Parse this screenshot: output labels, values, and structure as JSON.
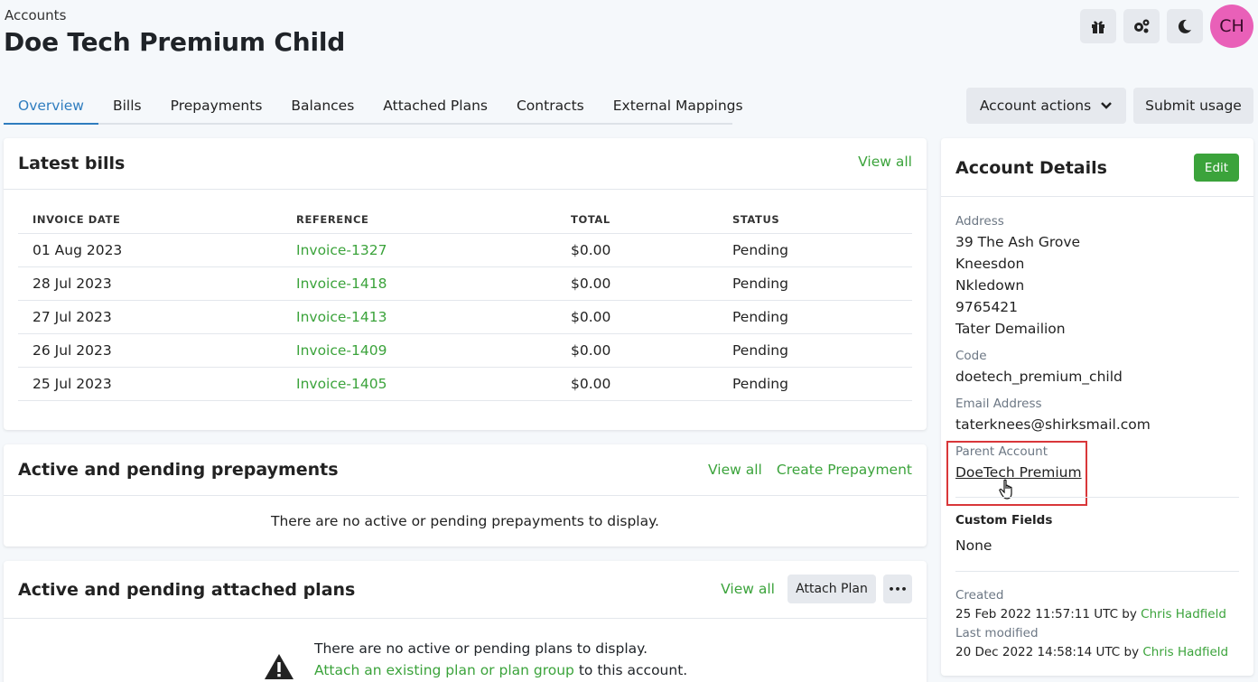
{
  "header": {
    "breadcrumb": "Accounts",
    "title": "Doe Tech Premium Child",
    "avatar_initials": "CH",
    "icons": [
      "gift-icon",
      "gears-icon",
      "moon-icon"
    ]
  },
  "tabs": [
    "Overview",
    "Bills",
    "Prepayments",
    "Balances",
    "Attached Plans",
    "Contracts",
    "External Mappings"
  ],
  "actions": {
    "account_actions": "Account actions",
    "submit_usage": "Submit usage"
  },
  "latest_bills": {
    "title": "Latest bills",
    "view_all": "View all",
    "columns": [
      "INVOICE DATE",
      "REFERENCE",
      "TOTAL",
      "STATUS"
    ],
    "rows": [
      {
        "date": "01 Aug 2023",
        "ref": "Invoice-1327",
        "total": "$0.00",
        "status": "Pending"
      },
      {
        "date": "28 Jul 2023",
        "ref": "Invoice-1418",
        "total": "$0.00",
        "status": "Pending"
      },
      {
        "date": "27 Jul 2023",
        "ref": "Invoice-1413",
        "total": "$0.00",
        "status": "Pending"
      },
      {
        "date": "26 Jul 2023",
        "ref": "Invoice-1409",
        "total": "$0.00",
        "status": "Pending"
      },
      {
        "date": "25 Jul 2023",
        "ref": "Invoice-1405",
        "total": "$0.00",
        "status": "Pending"
      }
    ]
  },
  "prepayments": {
    "title": "Active and pending prepayments",
    "view_all": "View all",
    "create": "Create Prepayment",
    "empty": "There are no active or pending prepayments to display."
  },
  "plans": {
    "title": "Active and pending attached plans",
    "view_all": "View all",
    "attach": "Attach Plan",
    "more": "•••",
    "empty": "There are no active or pending plans to display.",
    "attach_link": "Attach an existing plan or plan group",
    "attach_suffix": "to this account."
  },
  "details": {
    "title": "Account Details",
    "edit": "Edit",
    "address_label": "Address",
    "address_lines": [
      "39 The Ash Grove",
      "Kneesdon",
      "Nkledown",
      "9765421",
      "Tater Demailion"
    ],
    "code_label": "Code",
    "code": "doetech_premium_child",
    "email_label": "Email Address",
    "email": "taterknees@shirksmail.com",
    "parent_label": "Parent Account",
    "parent": "DoeTech Premium",
    "custom_label": "Custom Fields",
    "custom": "None",
    "created_label": "Created",
    "created": "25 Feb 2022 11:57:11 UTC by",
    "created_by": "Chris Hadfield",
    "modified_label": "Last modified",
    "modified": "20 Dec 2022 14:58:14 UTC by",
    "modified_by": "Chris Hadfield"
  },
  "colors": {
    "accent_green": "#3ba33b",
    "tab_blue": "#2f7dbf",
    "highlight_red": "#d9373a",
    "avatar_pink": "#e960b8"
  }
}
